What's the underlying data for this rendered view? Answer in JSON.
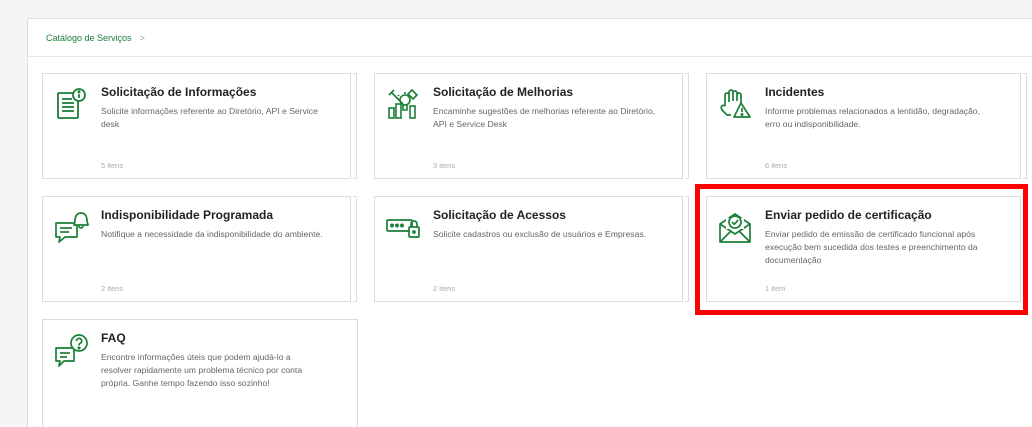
{
  "breadcrumb": {
    "root": "Catálogo de Serviços",
    "separator": ">"
  },
  "cards": [
    {
      "title": "Solicitação de Informações",
      "description": "Solicite informações referente ao Diretório, API e Service desk",
      "count": "5 itens",
      "icon": "document-info-icon"
    },
    {
      "title": "Solicitação de Melhorias",
      "description": "Encaminhe sugestões de melhorias referente ao Diretório, API e Service Desk",
      "count": "3 itens",
      "icon": "tools-lightbulb-icon"
    },
    {
      "title": "Incidentes",
      "description": "Informe problemas relacionados a lentidão, degradação, erro ou indisponibilidade.",
      "count": "6 itens",
      "icon": "hand-warning-icon"
    },
    {
      "title": "Indisponibilidade Programada",
      "description": "Notifique a necessidade da indisponibilidade do ambiente.",
      "count": "2 itens",
      "icon": "chat-bell-icon"
    },
    {
      "title": "Solicitação de Acessos",
      "description": "Solicite cadastros ou exclusão de usuários e Empresas.",
      "count": "2 itens",
      "icon": "password-lock-icon"
    },
    {
      "title": "Enviar pedido de certificação",
      "description": "Enviar pedido de emissão de certificado funcional após execução bem sucedida dos testes e preenchimento da documentação",
      "count": "1 item",
      "icon": "envelope-check-icon"
    },
    {
      "title": "FAQ",
      "description": "Encontre informações úteis que podem ajudá-lo a resolver rapidamente um problema técnico por conta própria. Ganhe tempo fazendo isso sozinho!",
      "count": "",
      "icon": "chat-question-icon"
    }
  ],
  "colors": {
    "icon_green": "#1a7f37",
    "highlight_red": "#ff0000"
  }
}
